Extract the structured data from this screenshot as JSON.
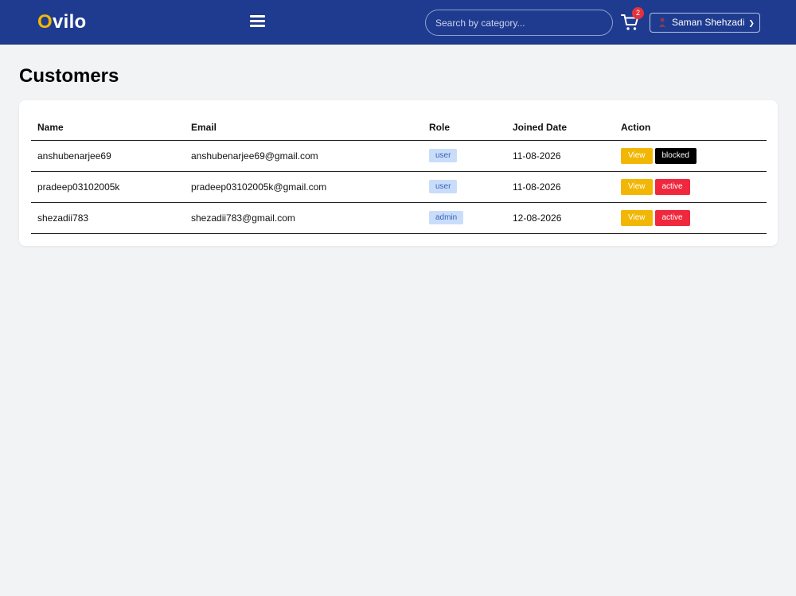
{
  "brand": {
    "first_letter": "O",
    "rest": "vilo"
  },
  "search": {
    "placeholder": "Search by category..."
  },
  "cart": {
    "count": "2"
  },
  "user": {
    "name": "Saman Shehzadi"
  },
  "page": {
    "title": "Customers"
  },
  "table": {
    "headers": [
      "Name",
      "Email",
      "Role",
      "Joined Date",
      "Action"
    ],
    "rows": [
      {
        "name": "anshubenarjee69",
        "email": "anshubenarjee69@gmail.com",
        "role": "user",
        "joined": "11-08-2026",
        "view_label": "View",
        "status_label": "blocked",
        "status_color": "#000000"
      },
      {
        "name": "pradeep03102005k",
        "email": "pradeep03102005k@gmail.com",
        "role": "user",
        "joined": "11-08-2026",
        "view_label": "View",
        "status_label": "active",
        "status_color": "#f0283e"
      },
      {
        "name": "shezadii783",
        "email": "shezadii783@gmail.com",
        "role": "admin",
        "joined": "12-08-2026",
        "view_label": "View",
        "status_label": "active",
        "status_color": "#f0283e"
      }
    ]
  },
  "colors": {
    "navbar": "#1f3b8f",
    "accent": "#f2b705",
    "danger": "#f0283e",
    "role_badge_bg": "#c9ddfb"
  },
  "icons": {
    "menu": "hamburger-icon",
    "cart": "cart-icon",
    "user": "user-icon",
    "dropdown": "chevron-down-icon"
  }
}
